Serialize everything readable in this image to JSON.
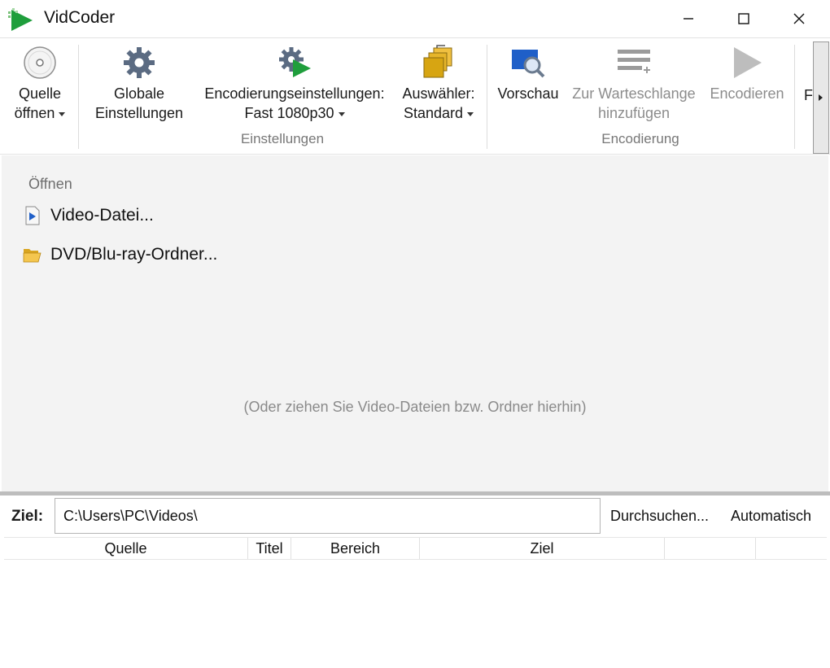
{
  "window": {
    "title": "VidCoder",
    "logo_icon": "vidcoder-logo-icon",
    "controls": [
      "minimize-icon",
      "maximize-icon",
      "close-icon"
    ]
  },
  "ribbon": {
    "source": {
      "line1": "Quelle",
      "line2": "öffnen",
      "icon": "disc-icon"
    },
    "global_settings": {
      "line1": "Globale",
      "line2": "Einstellungen",
      "icon": "gear-icon"
    },
    "encoding_settings": {
      "line1": "Encodierungseinstellungen:",
      "line2": "Fast 1080p30",
      "icon": "gear-play-icon"
    },
    "picker": {
      "line1": "Auswähler:",
      "line2": "Standard",
      "icon": "picker-icon"
    },
    "preview": {
      "line1": "Vorschau",
      "icon": "preview-magnifier-icon"
    },
    "add_queue": {
      "line1": "Zur Warteschlange",
      "line2": "hinzufügen",
      "icon": "add-queue-icon"
    },
    "encode": {
      "line1": "Encodieren",
      "icon": "play-icon"
    },
    "truncated_label": "F",
    "groups": {
      "settings": "Einstellungen",
      "encoding": "Encodierung"
    },
    "colors": {
      "disabled": "#8c8c8c",
      "gear": "#5b6b82",
      "play_green": "#1f9e3c",
      "preview_blue": "#1f5fc8",
      "picker_gold": "#d7a512"
    }
  },
  "open": {
    "heading": "Öffnen",
    "video_file": "Video-Datei...",
    "disc_folder": "DVD/Blu-ray-Ordner...",
    "drop_hint": "(Oder ziehen Sie Video-Dateien bzw. Ordner hierhin)"
  },
  "destination": {
    "label": "Ziel:",
    "path": "C:\\Users\\PC\\Videos\\",
    "browse": "Durchsuchen...",
    "auto": "Automatisch"
  },
  "queue": {
    "columns": [
      "Quelle",
      "Titel",
      "Bereich",
      "Ziel",
      "",
      ""
    ]
  }
}
